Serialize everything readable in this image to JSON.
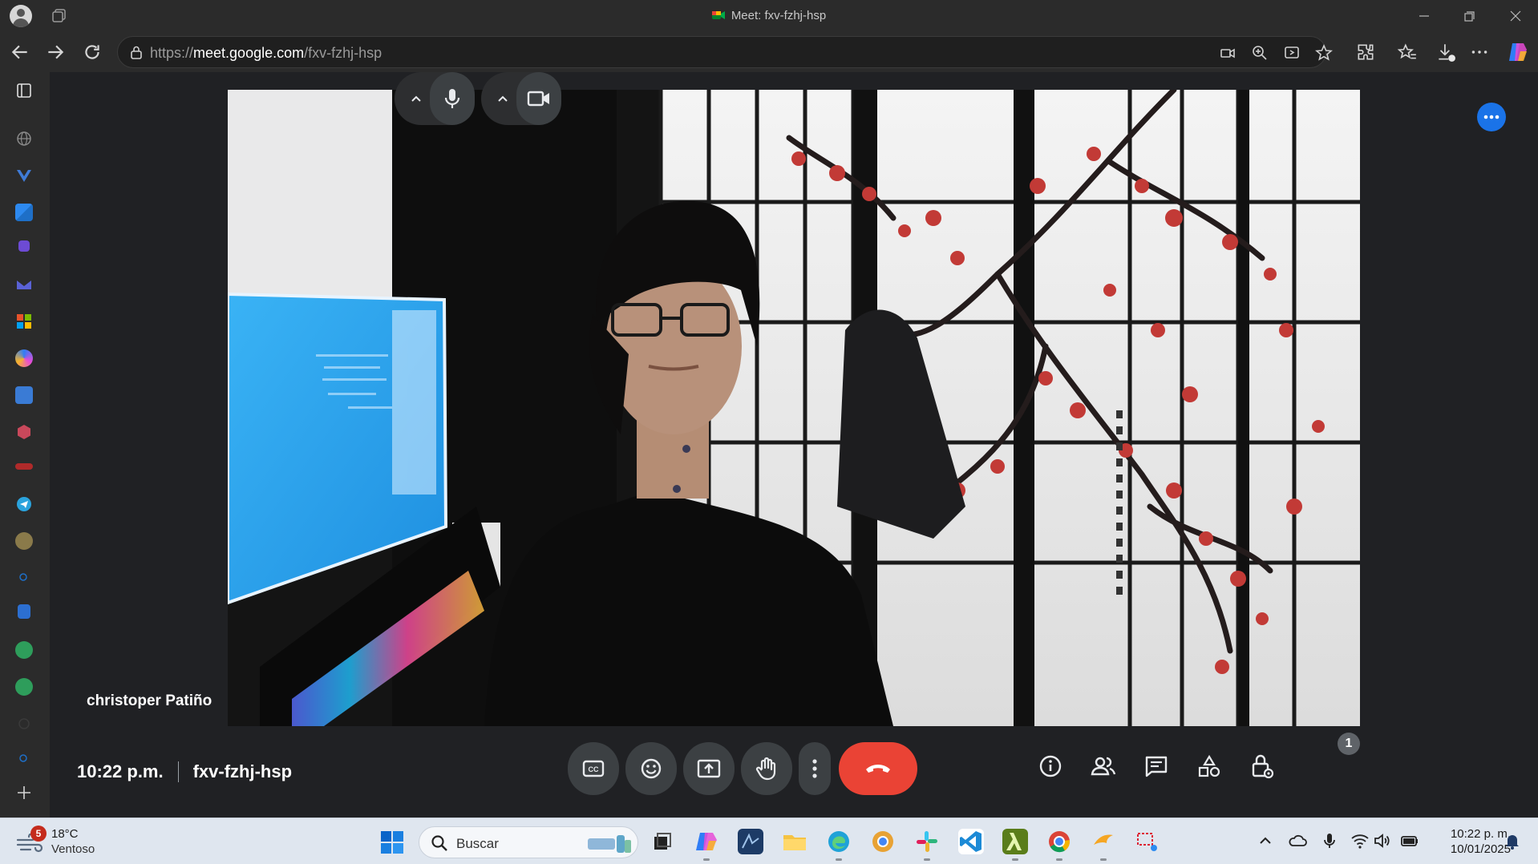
{
  "window": {
    "tab_title": "Meet: fxv-fzhj-hsp"
  },
  "address_bar": {
    "url_prefix": "https://",
    "url_host": "meet.google.com",
    "url_path": "/fxv-fzhj-hsp"
  },
  "meeting": {
    "participant_name": "christoper Patiño",
    "time": "10:22 p.m.",
    "code": "fxv-fzhj-hsp",
    "people_count": "1"
  },
  "taskbar": {
    "weather_temp": "18°C",
    "weather_condition": "Ventoso",
    "weather_badge": "5",
    "search_placeholder": "Buscar",
    "clock_time": "10:22 p. m.",
    "clock_date": "10/01/2025"
  },
  "colors": {
    "leave_red": "#ea4335",
    "meet_blue": "#1a73e8",
    "meet_bg": "#202124",
    "control_grey": "#3c4043"
  }
}
